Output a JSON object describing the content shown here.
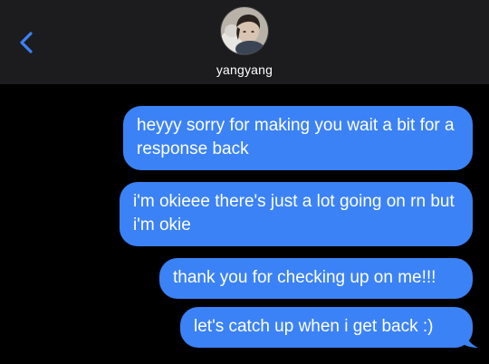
{
  "header": {
    "contact_name": "yangyang",
    "back_icon": "chevron-left-icon",
    "accent_color": "#3b82f6"
  },
  "messages": [
    {
      "direction": "outgoing",
      "text": "heyyy sorry for making you wait a bit for a response back"
    },
    {
      "direction": "outgoing",
      "text": "i'm okieee there's just a lot going on rn but i'm okie"
    },
    {
      "direction": "outgoing",
      "text": "thank you for checking up on me!!!"
    },
    {
      "direction": "outgoing",
      "text": "let's catch up when i get back :)"
    }
  ],
  "colors": {
    "background": "#000000",
    "header_background": "#1c1c1e",
    "bubble": "#3b82f6",
    "bubble_text": "#ffffff"
  }
}
